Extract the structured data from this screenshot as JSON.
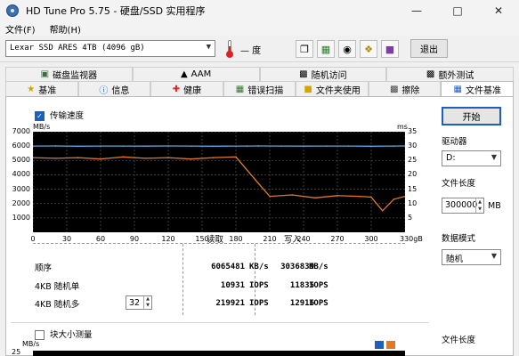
{
  "window": {
    "title": "HD Tune Pro 5.75 - 硬盘/SSD 实用程序"
  },
  "menu": [
    "文件(F)",
    "帮助(H)"
  ],
  "toolbar": {
    "drive": "Lexar SSD ARES 4TB (4096 gB)",
    "temperature": "— 度",
    "exit_label": "退出"
  },
  "tabs_row1": [
    {
      "label": "磁盘监视器",
      "icon": "monitor-icon"
    },
    {
      "label": "AAM",
      "icon": "speaker-icon"
    },
    {
      "label": "随机访问",
      "icon": "random-access-icon"
    },
    {
      "label": "额外测试",
      "icon": "extra-tests-icon"
    }
  ],
  "tabs_row2": [
    {
      "label": "基准",
      "icon": "benchmark-icon"
    },
    {
      "label": "信息",
      "icon": "info-icon"
    },
    {
      "label": "健康",
      "icon": "health-icon"
    },
    {
      "label": "错误扫描",
      "icon": "error-scan-icon"
    },
    {
      "label": "文件夹使用",
      "icon": "folder-icon"
    },
    {
      "label": "擦除",
      "icon": "erase-icon"
    },
    {
      "label": "文件基准",
      "icon": "file-benchmark-icon",
      "active": true
    }
  ],
  "transfer": {
    "label": "传输速度",
    "checked": true
  },
  "chart_data": {
    "type": "line",
    "ylabel_left": "MB/s",
    "ylabel_right": "ms",
    "y_left_ticks": [
      "7000",
      "6000",
      "5000",
      "4000",
      "3000",
      "2000",
      "1000"
    ],
    "y_right_ticks": [
      "35",
      "30",
      "25",
      "20",
      "15",
      "10",
      "5"
    ],
    "x_ticks": [
      "0",
      "30",
      "60",
      "90",
      "120",
      "150",
      "180",
      "210",
      "240",
      "270",
      "300",
      "330gB"
    ],
    "ylim": [
      0,
      7000
    ],
    "ylim_right": [
      0,
      35
    ],
    "xlim": [
      0,
      330
    ],
    "series": [
      {
        "name": "读取",
        "color": "#5ea7de",
        "x": [
          0,
          20,
          40,
          60,
          80,
          100,
          120,
          140,
          160,
          180,
          190,
          200,
          220,
          240,
          260,
          280,
          300,
          320,
          330
        ],
        "values": [
          6000,
          6010,
          5990,
          6005,
          6000,
          5995,
          6010,
          6000,
          5990,
          6000,
          6005,
          6010,
          6000,
          5995,
          6005,
          6000,
          5990,
          6000,
          6010
        ]
      },
      {
        "name": "写入",
        "color": "#e07a2b",
        "x": [
          0,
          20,
          40,
          60,
          80,
          100,
          120,
          140,
          160,
          180,
          200,
          210,
          230,
          250,
          270,
          290,
          300,
          310,
          320,
          330
        ],
        "values": [
          5200,
          5150,
          5200,
          5100,
          5250,
          5150,
          5200,
          5100,
          5200,
          5250,
          3400,
          2500,
          2600,
          2400,
          2550,
          2500,
          2450,
          1500,
          2300,
          2500
        ]
      }
    ]
  },
  "results": {
    "col_read": "读取",
    "col_write": "写入",
    "rows": [
      {
        "label": "顺序",
        "read": "6065481",
        "read_unit": "KB/s",
        "write": "3036839",
        "write_unit": "KB/s"
      },
      {
        "label": "4KB 随机单",
        "read": "10931",
        "read_unit": "IOPS",
        "write": "11835",
        "write_unit": "IOPS"
      },
      {
        "label": "4KB 随机多",
        "queue": "32",
        "read": "219921",
        "read_unit": "IOPS",
        "write": "12916",
        "write_unit": "IOPS"
      }
    ]
  },
  "block_test": {
    "label": "块大小测量",
    "checked": false,
    "ylabel": "MB/s",
    "ymax": "25"
  },
  "legend_icon": "legend-icon",
  "sidebar": {
    "start_label": "开始",
    "drive_label": "驱动器",
    "drive_value": "D:",
    "file_length_label": "文件长度",
    "file_length_value": "300000",
    "file_length_unit": "MB",
    "data_mode_label": "数据模式",
    "data_mode_value": "随机",
    "file_length_label2": "文件长度"
  }
}
